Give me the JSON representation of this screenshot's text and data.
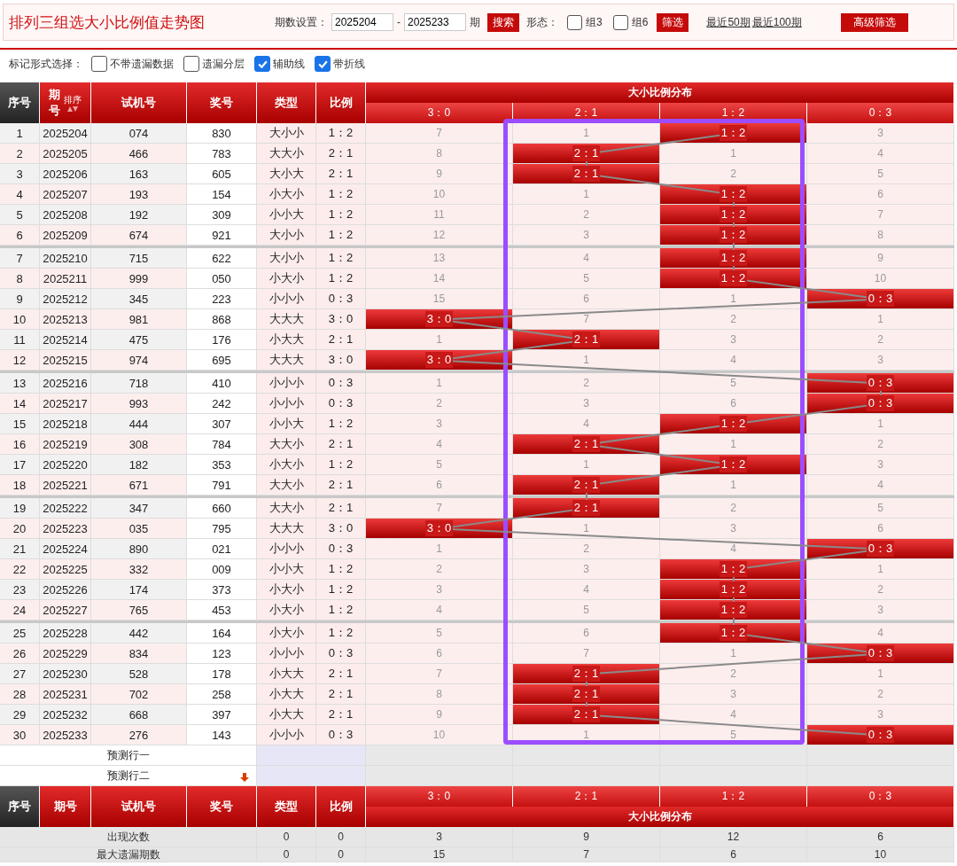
{
  "topbar": {
    "title": "排列三组选大小比例值走势图",
    "period_label": "期数设置：",
    "period_from": "2025204",
    "period_dash": "-",
    "period_to": "2025233",
    "period_unit": "期",
    "search_button": "搜索",
    "shape_label": "形态：",
    "shape_options": [
      {
        "label": "组3",
        "checked": false
      },
      {
        "label": "组6",
        "checked": false
      }
    ],
    "filter_button": "筛选",
    "links": [
      "最近50期",
      "最近100期"
    ],
    "advanced_button": "高级筛选"
  },
  "marker_bar": {
    "label": "标记形式选择：",
    "options": [
      {
        "label": "不带遗漏数据",
        "checked": false
      },
      {
        "label": "遗漏分层",
        "checked": false
      },
      {
        "label": "辅助线",
        "checked": true
      },
      {
        "label": "带折线",
        "checked": true
      }
    ]
  },
  "header": {
    "seq": "序号",
    "issue": [
      "期",
      "号"
    ],
    "sort": "排序",
    "test": "试机号",
    "draw": "奖号",
    "type": "类型",
    "ratio": "比例",
    "dist": "大小比例分布",
    "dist_cols": [
      "3：0",
      "2：1",
      "1：2",
      "0：3"
    ]
  },
  "rows": [
    {
      "no": "1",
      "issue": "2025204",
      "test": "074",
      "draw": "830",
      "type": "大小小",
      "ratio": "1：2",
      "cells": [
        {
          "text": "7",
          "hit": false
        },
        {
          "text": "1",
          "hit": false
        },
        {
          "text": "1：2",
          "hit": true
        },
        {
          "text": "3",
          "hit": false
        }
      ]
    },
    {
      "no": "2",
      "issue": "2025205",
      "test": "466",
      "draw": "783",
      "type": "大大小",
      "ratio": "2：1",
      "cells": [
        {
          "text": "8",
          "hit": false
        },
        {
          "text": "2：1",
          "hit": true
        },
        {
          "text": "1",
          "hit": false
        },
        {
          "text": "4",
          "hit": false
        }
      ]
    },
    {
      "no": "3",
      "issue": "2025206",
      "test": "163",
      "draw": "605",
      "type": "大小大",
      "ratio": "2：1",
      "cells": [
        {
          "text": "9",
          "hit": false
        },
        {
          "text": "2：1",
          "hit": true
        },
        {
          "text": "2",
          "hit": false
        },
        {
          "text": "5",
          "hit": false
        }
      ]
    },
    {
      "no": "4",
      "issue": "2025207",
      "test": "193",
      "draw": "154",
      "type": "小大小",
      "ratio": "1：2",
      "cells": [
        {
          "text": "10",
          "hit": false
        },
        {
          "text": "1",
          "hit": false
        },
        {
          "text": "1：2",
          "hit": true
        },
        {
          "text": "6",
          "hit": false
        }
      ]
    },
    {
      "no": "5",
      "issue": "2025208",
      "test": "192",
      "draw": "309",
      "type": "小小大",
      "ratio": "1：2",
      "cells": [
        {
          "text": "11",
          "hit": false
        },
        {
          "text": "2",
          "hit": false
        },
        {
          "text": "1：2",
          "hit": true
        },
        {
          "text": "7",
          "hit": false
        }
      ]
    },
    {
      "no": "6",
      "issue": "2025209",
      "test": "674",
      "draw": "921",
      "type": "大小小",
      "ratio": "1：2",
      "cells": [
        {
          "text": "12",
          "hit": false
        },
        {
          "text": "3",
          "hit": false
        },
        {
          "text": "1：2",
          "hit": true
        },
        {
          "text": "8",
          "hit": false
        }
      ]
    },
    {
      "no": "7",
      "issue": "2025210",
      "test": "715",
      "draw": "622",
      "type": "大小小",
      "ratio": "1：2",
      "cells": [
        {
          "text": "13",
          "hit": false
        },
        {
          "text": "4",
          "hit": false
        },
        {
          "text": "1：2",
          "hit": true
        },
        {
          "text": "9",
          "hit": false
        }
      ]
    },
    {
      "no": "8",
      "issue": "2025211",
      "test": "999",
      "draw": "050",
      "type": "小大小",
      "ratio": "1：2",
      "cells": [
        {
          "text": "14",
          "hit": false
        },
        {
          "text": "5",
          "hit": false
        },
        {
          "text": "1：2",
          "hit": true
        },
        {
          "text": "10",
          "hit": false
        }
      ]
    },
    {
      "no": "9",
      "issue": "2025212",
      "test": "345",
      "draw": "223",
      "type": "小小小",
      "ratio": "0：3",
      "cells": [
        {
          "text": "15",
          "hit": false
        },
        {
          "text": "6",
          "hit": false
        },
        {
          "text": "1",
          "hit": false
        },
        {
          "text": "0：3",
          "hit": true
        }
      ]
    },
    {
      "no": "10",
      "issue": "2025213",
      "test": "981",
      "draw": "868",
      "type": "大大大",
      "ratio": "3：0",
      "cells": [
        {
          "text": "3：0",
          "hit": true
        },
        {
          "text": "7",
          "hit": false
        },
        {
          "text": "2",
          "hit": false
        },
        {
          "text": "1",
          "hit": false
        }
      ]
    },
    {
      "no": "11",
      "issue": "2025214",
      "test": "475",
      "draw": "176",
      "type": "小大大",
      "ratio": "2：1",
      "cells": [
        {
          "text": "1",
          "hit": false
        },
        {
          "text": "2：1",
          "hit": true
        },
        {
          "text": "3",
          "hit": false
        },
        {
          "text": "2",
          "hit": false
        }
      ]
    },
    {
      "no": "12",
      "issue": "2025215",
      "test": "974",
      "draw": "695",
      "type": "大大大",
      "ratio": "3：0",
      "cells": [
        {
          "text": "3：0",
          "hit": true
        },
        {
          "text": "1",
          "hit": false
        },
        {
          "text": "4",
          "hit": false
        },
        {
          "text": "3",
          "hit": false
        }
      ]
    },
    {
      "no": "13",
      "issue": "2025216",
      "test": "718",
      "draw": "410",
      "type": "小小小",
      "ratio": "0：3",
      "cells": [
        {
          "text": "1",
          "hit": false
        },
        {
          "text": "2",
          "hit": false
        },
        {
          "text": "5",
          "hit": false
        },
        {
          "text": "0：3",
          "hit": true
        }
      ]
    },
    {
      "no": "14",
      "issue": "2025217",
      "test": "993",
      "draw": "242",
      "type": "小小小",
      "ratio": "0：3",
      "cells": [
        {
          "text": "2",
          "hit": false
        },
        {
          "text": "3",
          "hit": false
        },
        {
          "text": "6",
          "hit": false
        },
        {
          "text": "0：3",
          "hit": true
        }
      ]
    },
    {
      "no": "15",
      "issue": "2025218",
      "test": "444",
      "draw": "307",
      "type": "小小大",
      "ratio": "1：2",
      "cells": [
        {
          "text": "3",
          "hit": false
        },
        {
          "text": "4",
          "hit": false
        },
        {
          "text": "1：2",
          "hit": true
        },
        {
          "text": "1",
          "hit": false
        }
      ]
    },
    {
      "no": "16",
      "issue": "2025219",
      "test": "308",
      "draw": "784",
      "type": "大大小",
      "ratio": "2：1",
      "cells": [
        {
          "text": "4",
          "hit": false
        },
        {
          "text": "2：1",
          "hit": true
        },
        {
          "text": "1",
          "hit": false
        },
        {
          "text": "2",
          "hit": false
        }
      ]
    },
    {
      "no": "17",
      "issue": "2025220",
      "test": "182",
      "draw": "353",
      "type": "小大小",
      "ratio": "1：2",
      "cells": [
        {
          "text": "5",
          "hit": false
        },
        {
          "text": "1",
          "hit": false
        },
        {
          "text": "1：2",
          "hit": true
        },
        {
          "text": "3",
          "hit": false
        }
      ]
    },
    {
      "no": "18",
      "issue": "2025221",
      "test": "671",
      "draw": "791",
      "type": "大大小",
      "ratio": "2：1",
      "cells": [
        {
          "text": "6",
          "hit": false
        },
        {
          "text": "2：1",
          "hit": true
        },
        {
          "text": "1",
          "hit": false
        },
        {
          "text": "4",
          "hit": false
        }
      ]
    },
    {
      "no": "19",
      "issue": "2025222",
      "test": "347",
      "draw": "660",
      "type": "大大小",
      "ratio": "2：1",
      "cells": [
        {
          "text": "7",
          "hit": false
        },
        {
          "text": "2：1",
          "hit": true
        },
        {
          "text": "2",
          "hit": false
        },
        {
          "text": "5",
          "hit": false
        }
      ]
    },
    {
      "no": "20",
      "issue": "2025223",
      "test": "035",
      "draw": "795",
      "type": "大大大",
      "ratio": "3：0",
      "cells": [
        {
          "text": "3：0",
          "hit": true
        },
        {
          "text": "1",
          "hit": false
        },
        {
          "text": "3",
          "hit": false
        },
        {
          "text": "6",
          "hit": false
        }
      ]
    },
    {
      "no": "21",
      "issue": "2025224",
      "test": "890",
      "draw": "021",
      "type": "小小小",
      "ratio": "0：3",
      "cells": [
        {
          "text": "1",
          "hit": false
        },
        {
          "text": "2",
          "hit": false
        },
        {
          "text": "4",
          "hit": false
        },
        {
          "text": "0：3",
          "hit": true
        }
      ]
    },
    {
      "no": "22",
      "issue": "2025225",
      "test": "332",
      "draw": "009",
      "type": "小小大",
      "ratio": "1：2",
      "cells": [
        {
          "text": "2",
          "hit": false
        },
        {
          "text": "3",
          "hit": false
        },
        {
          "text": "1：2",
          "hit": true
        },
        {
          "text": "1",
          "hit": false
        }
      ]
    },
    {
      "no": "23",
      "issue": "2025226",
      "test": "174",
      "draw": "373",
      "type": "小大小",
      "ratio": "1：2",
      "cells": [
        {
          "text": "3",
          "hit": false
        },
        {
          "text": "4",
          "hit": false
        },
        {
          "text": "1：2",
          "hit": true
        },
        {
          "text": "2",
          "hit": false
        }
      ]
    },
    {
      "no": "24",
      "issue": "2025227",
      "test": "765",
      "draw": "453",
      "type": "小大小",
      "ratio": "1：2",
      "cells": [
        {
          "text": "4",
          "hit": false
        },
        {
          "text": "5",
          "hit": false
        },
        {
          "text": "1：2",
          "hit": true
        },
        {
          "text": "3",
          "hit": false
        }
      ]
    },
    {
      "no": "25",
      "issue": "2025228",
      "test": "442",
      "draw": "164",
      "type": "小大小",
      "ratio": "1：2",
      "cells": [
        {
          "text": "5",
          "hit": false
        },
        {
          "text": "6",
          "hit": false
        },
        {
          "text": "1：2",
          "hit": true
        },
        {
          "text": "4",
          "hit": false
        }
      ]
    },
    {
      "no": "26",
      "issue": "2025229",
      "test": "834",
      "draw": "123",
      "type": "小小小",
      "ratio": "0：3",
      "cells": [
        {
          "text": "6",
          "hit": false
        },
        {
          "text": "7",
          "hit": false
        },
        {
          "text": "1",
          "hit": false
        },
        {
          "text": "0：3",
          "hit": true
        }
      ]
    },
    {
      "no": "27",
      "issue": "2025230",
      "test": "528",
      "draw": "178",
      "type": "小大大",
      "ratio": "2：1",
      "cells": [
        {
          "text": "7",
          "hit": false
        },
        {
          "text": "2：1",
          "hit": true
        },
        {
          "text": "2",
          "hit": false
        },
        {
          "text": "1",
          "hit": false
        }
      ]
    },
    {
      "no": "28",
      "issue": "2025231",
      "test": "702",
      "draw": "258",
      "type": "小大大",
      "ratio": "2：1",
      "cells": [
        {
          "text": "8",
          "hit": false
        },
        {
          "text": "2：1",
          "hit": true
        },
        {
          "text": "3",
          "hit": false
        },
        {
          "text": "2",
          "hit": false
        }
      ]
    },
    {
      "no": "29",
      "issue": "2025232",
      "test": "668",
      "draw": "397",
      "type": "小大大",
      "ratio": "2：1",
      "cells": [
        {
          "text": "9",
          "hit": false
        },
        {
          "text": "2：1",
          "hit": true
        },
        {
          "text": "4",
          "hit": false
        },
        {
          "text": "3",
          "hit": false
        }
      ]
    },
    {
      "no": "30",
      "issue": "2025233",
      "test": "276",
      "draw": "143",
      "type": "小小小",
      "ratio": "0：3",
      "cells": [
        {
          "text": "10",
          "hit": false
        },
        {
          "text": "1",
          "hit": false
        },
        {
          "text": "5",
          "hit": false
        },
        {
          "text": "0：3",
          "hit": true
        }
      ]
    }
  ],
  "prediction_rows": [
    "预测行一",
    "预测行二"
  ],
  "footer_header": {
    "seq": "序号",
    "issue": "期号",
    "test": "试机号",
    "draw": "奖号",
    "type": "类型",
    "ratio": "比例",
    "dist_cols": [
      "3：0",
      "2：1",
      "1：2",
      "0：3"
    ],
    "dist": "大小比例分布"
  },
  "stats": [
    {
      "label": "出现次数",
      "type": "0",
      "ratio": "0",
      "values": [
        "3",
        "9",
        "12",
        "6"
      ]
    },
    {
      "label": "最大遗漏期数",
      "type": "0",
      "ratio": "0",
      "values": [
        "15",
        "7",
        "6",
        "10"
      ]
    }
  ],
  "highlight": {
    "kind": "frame"
  }
}
